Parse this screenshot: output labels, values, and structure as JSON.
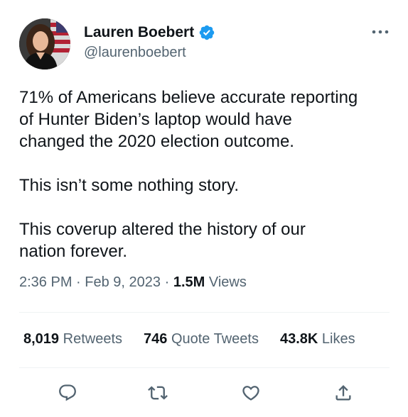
{
  "author": {
    "display_name": "Lauren Boebert",
    "handle": "@laurenboebert",
    "verified": true,
    "verified_color": "#1d9bf0"
  },
  "tweet": {
    "paragraphs": [
      "71% of Americans believe accurate reporting",
      "of Hunter Biden’s laptop would have",
      "changed the 2020 election outcome.",
      "This isn’t some nothing story.",
      "This coverup altered the history of our",
      "nation forever."
    ]
  },
  "meta": {
    "time": "2:36 PM",
    "separator": "·",
    "date": "Feb 9, 2023",
    "views_count": "1.5M",
    "views_label": "Views"
  },
  "stats": {
    "retweets_count": "8,019",
    "retweets_label": "Retweets",
    "quotes_count": "746",
    "quotes_label": "Quote Tweets",
    "likes_count": "43.8K",
    "likes_label": "Likes"
  },
  "icons": {
    "more": "more-icon",
    "reply": "reply-icon",
    "retweet": "retweet-icon",
    "like": "like-icon",
    "share": "share-icon"
  },
  "colors": {
    "text_primary": "#0f1419",
    "text_secondary": "#536471",
    "divider": "#eff3f4"
  }
}
